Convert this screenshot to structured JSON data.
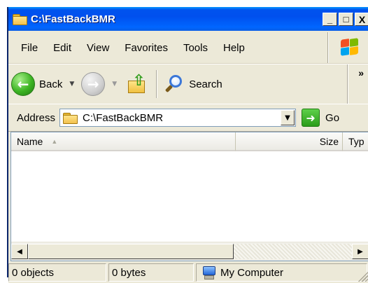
{
  "window": {
    "title": "C:\\FastBackBMR",
    "minimize_label": "_",
    "maximize_label": "□",
    "close_label": "X"
  },
  "menu": {
    "items": [
      "File",
      "Edit",
      "View",
      "Favorites",
      "Tools",
      "Help"
    ]
  },
  "toolbar": {
    "back_label": "Back",
    "search_label": "Search",
    "overflow_label": "»",
    "icons": [
      "back-arrow-icon",
      "forward-arrow-icon",
      "folder-up-icon",
      "search-icon"
    ]
  },
  "address": {
    "label": "Address",
    "value": "C:\\FastBackBMR",
    "go_label": "Go"
  },
  "listview": {
    "columns": [
      "Name",
      "Size",
      "Typ"
    ]
  },
  "statusbar": {
    "objects": "0 objects",
    "bytes": "0 bytes",
    "zone": "My Computer"
  },
  "colors": {
    "titlebar": "#0053ee",
    "chrome": "#ece9d8",
    "go_green": "#2a9c1a"
  }
}
